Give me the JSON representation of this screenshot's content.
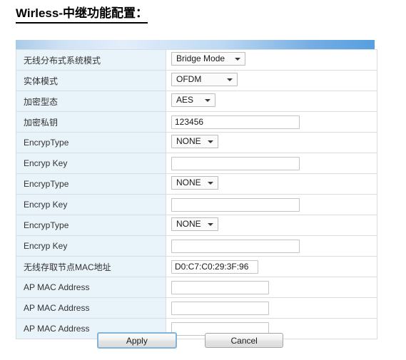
{
  "page": {
    "title": "Wirless-中继功能配置："
  },
  "theme": {
    "header_gradient_left": "#aacbe8",
    "header_gradient_right": "#579fe0",
    "label_cell_bg": "#e9f3fa",
    "table_border": "#d6dde4",
    "focus_border": "#7fb4dd"
  },
  "form": {
    "rows": [
      {
        "label": "无线分布式系统模式",
        "control": "select",
        "value": "Bridge Mode",
        "size": "wide"
      },
      {
        "label": "实体模式",
        "control": "select",
        "value": "OFDM",
        "size": "medium"
      },
      {
        "label": "加密型态",
        "control": "select",
        "value": "AES",
        "size": "small"
      },
      {
        "label": "加密私钥",
        "control": "text",
        "value": "123456",
        "size": "long",
        "placeholder": ""
      },
      {
        "label": "EncrypType",
        "control": "select",
        "value": "NONE",
        "size": "none"
      },
      {
        "label": "Encryp Key",
        "control": "text",
        "value": "",
        "size": "long",
        "placeholder": ""
      },
      {
        "label": "EncrypType",
        "control": "select",
        "value": "NONE",
        "size": "none"
      },
      {
        "label": "Encryp Key",
        "control": "text",
        "value": "",
        "size": "long",
        "placeholder": ""
      },
      {
        "label": "EncrypType",
        "control": "select",
        "value": "NONE",
        "size": "none"
      },
      {
        "label": "Encryp Key",
        "control": "text",
        "value": "",
        "size": "long",
        "placeholder": ""
      },
      {
        "label": "无线存取节点MAC地址",
        "control": "text",
        "value": "D0:C7:C0:29:3F:96",
        "size": "mac",
        "placeholder": ""
      },
      {
        "label": "AP MAC Address",
        "control": "text",
        "value": "",
        "size": "apmac",
        "placeholder": ""
      },
      {
        "label": "AP MAC Address",
        "control": "text",
        "value": "",
        "size": "apmac",
        "placeholder": ""
      },
      {
        "label": "AP MAC Address",
        "control": "text",
        "value": "",
        "size": "apmac",
        "placeholder": ""
      }
    ]
  },
  "buttons": {
    "apply_label": "Apply",
    "cancel_label": "Cancel"
  }
}
